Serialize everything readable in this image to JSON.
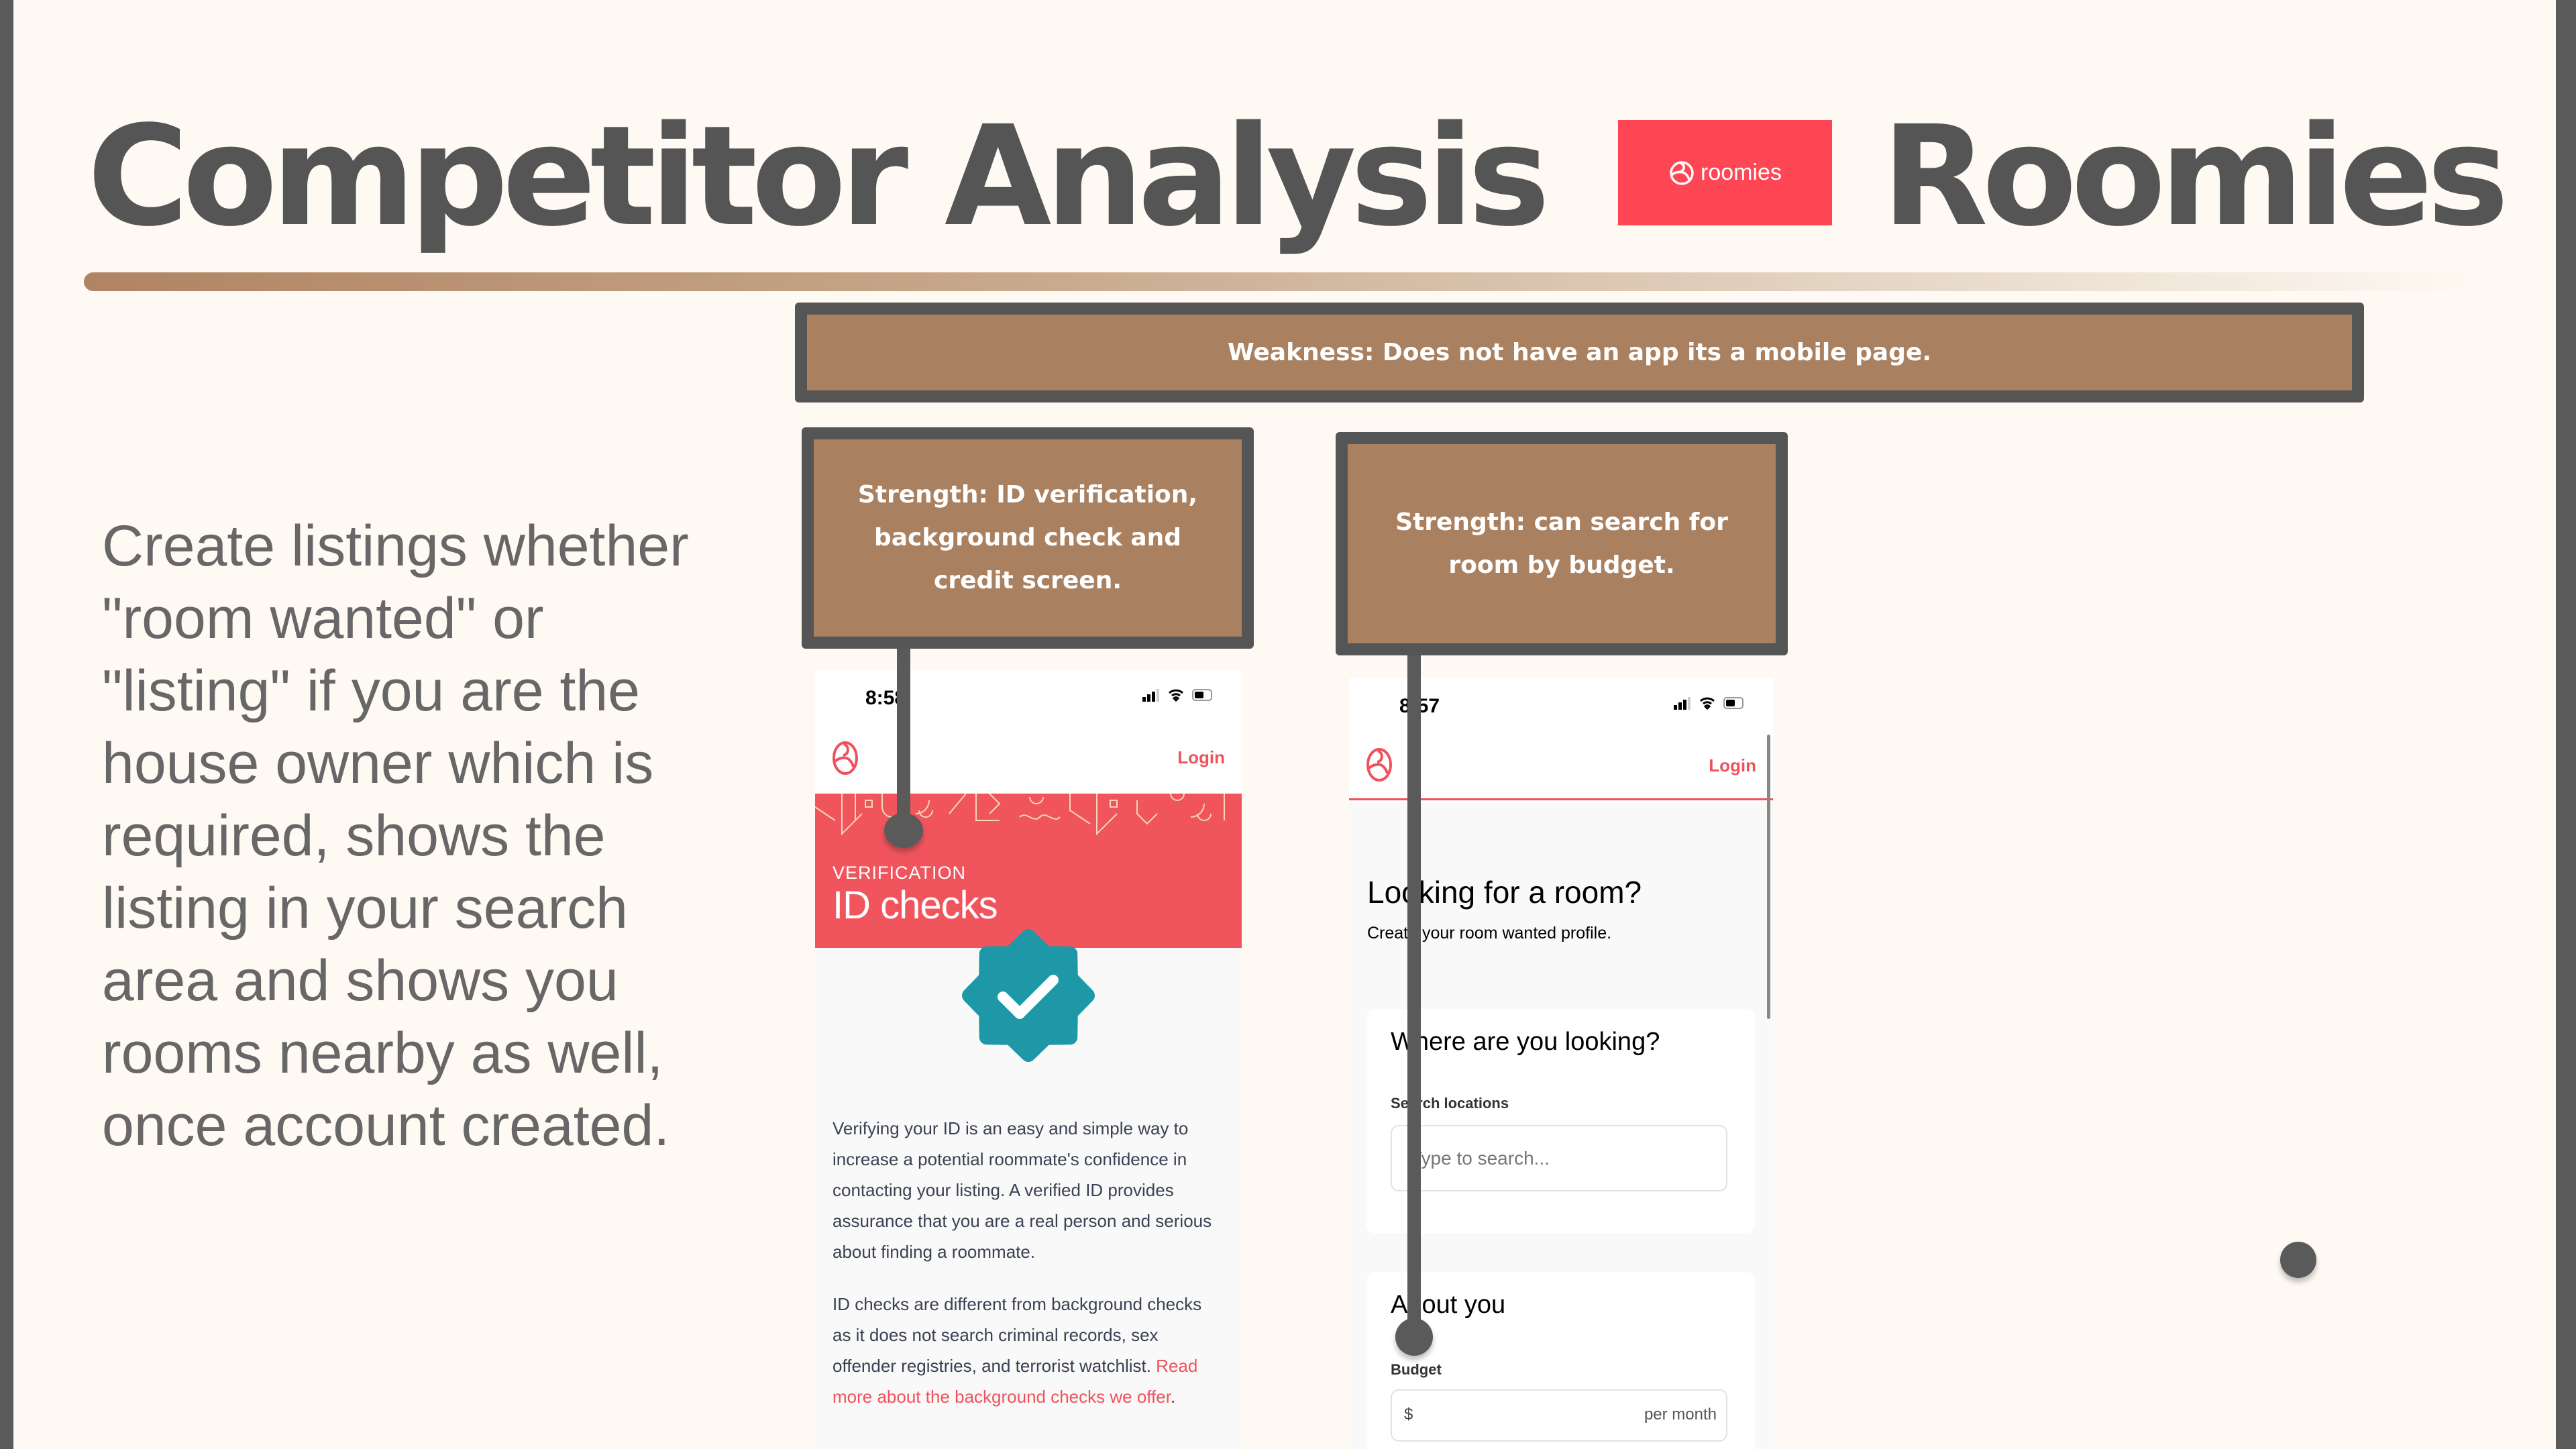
{
  "title": "Competitor Analysis",
  "brand_title": "Roomies",
  "logo": {
    "text": "roomies",
    "color": "#ff4655"
  },
  "colors": {
    "note_fill": "#a98060",
    "note_border": "#555555",
    "accent": "#f0555d",
    "badge": "#1e97a6"
  },
  "weakness": "Weakness: Does not have an app its a mobile page.",
  "strength1": "Strength: ID verification, background check and credit screen.",
  "strength2": "Strength: can search for room by budget.",
  "description": [
    "Create listings whether",
    "\"room wanted\" or",
    "\"listing\" if you are the",
    "house owner which is",
    "required, shows the",
    "listing in your search",
    "area and shows you",
    "rooms nearby as well,",
    "once account created."
  ],
  "phone1": {
    "time": "8:58",
    "login": "Login",
    "eyebrow": "VERIFICATION",
    "heading": "ID checks",
    "para1": [
      "Verifying your ID is an easy and simple way to",
      "increase a potential roommate's confidence in",
      "contacting your listing. A verified ID provides",
      "assurance that you are a real person and serious",
      "about finding a roommate."
    ],
    "para2": [
      "ID checks are different from background checks",
      "as it does not search criminal records, sex"
    ],
    "para2_line3": "offender registries, and terrorist watchlist. ",
    "link1": "Read",
    "link2": "more about the background checks we offer",
    "period": "."
  },
  "phone2": {
    "time": "8:57",
    "login": "Login",
    "heading": "Looking for a room?",
    "subheading": "Create your room wanted profile.",
    "card1_title": "Where are you looking?",
    "search_label": "Search locations",
    "search_placeholder": "Type to search...",
    "card2_title": "About you",
    "budget_label": "Budget",
    "currency": "$",
    "per_month": "per month"
  }
}
